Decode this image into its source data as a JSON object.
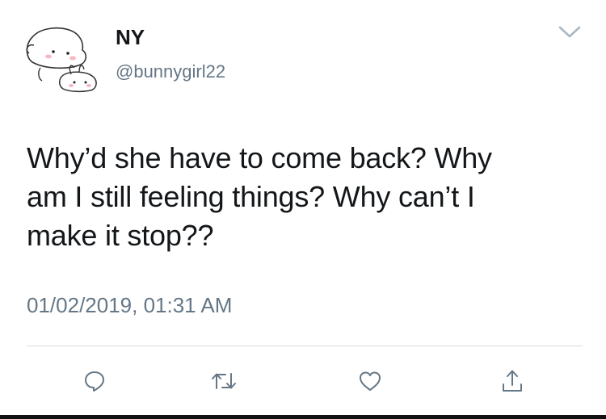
{
  "tweet": {
    "display_name": "NY",
    "handle": "@bunnygirl22",
    "text": "Why’d she have to come back? Why\nam I still feeling things? Why can’t I\nmake it stop??",
    "timestamp": "01/02/2019, 01:31 AM"
  },
  "icons": {
    "menu": "chevron-down-icon",
    "reply": "reply-icon",
    "retweet": "retweet-icon",
    "like": "heart-icon",
    "share": "share-icon"
  },
  "colors": {
    "text": "#14171a",
    "secondary": "#657786",
    "icon": "#657786",
    "divider": "#d6dadf"
  }
}
